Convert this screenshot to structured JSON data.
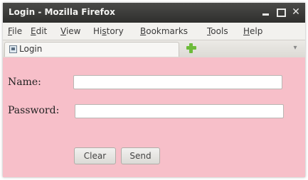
{
  "window": {
    "title": "Login - Mozilla Firefox",
    "controls": {
      "minimize": "_",
      "maximize": "□",
      "close": "✕"
    }
  },
  "menubar": {
    "items": [
      {
        "accel": "F",
        "rest": "ile"
      },
      {
        "accel": "E",
        "rest": "dit"
      },
      {
        "accel": "V",
        "rest": "iew"
      },
      {
        "pre": "Hi",
        "accel": "s",
        "rest": "tory"
      },
      {
        "accel": "B",
        "rest": "ookmarks"
      },
      {
        "accel": "T",
        "rest": "ools"
      },
      {
        "accel": "H",
        "rest": "elp"
      }
    ]
  },
  "tabs": {
    "active_label": "Login",
    "favicon": "page-icon",
    "new_tab_icon": "green-plus-icon",
    "dropdown_glyph": "▾"
  },
  "form": {
    "name_label": "Name:",
    "name_value": "",
    "password_label": "Password:",
    "password_value": "",
    "clear_label": "Clear",
    "send_label": "Send"
  },
  "colors": {
    "content_background": "#f7bfc9",
    "titlebar": "#3c3c3a",
    "new_tab_icon": "#6dbb3a"
  }
}
